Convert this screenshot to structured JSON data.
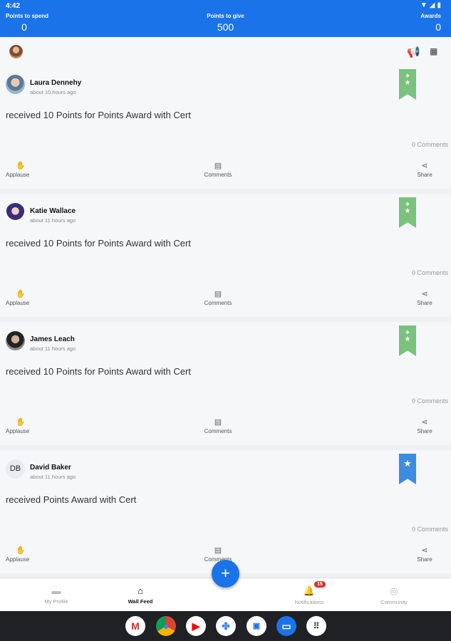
{
  "status_bar": {
    "time": "4:42"
  },
  "header": {
    "points_to_spend_label": "Points to spend",
    "points_to_spend_value": "0",
    "points_to_give_label": "Points to give",
    "points_to_give_value": "500",
    "awards_label": "Awards",
    "awards_value": "0"
  },
  "posts": [
    {
      "author": "Laura Dennehy",
      "time": "about 10 hours ago",
      "message": "received 10 Points for Points Award with Cert",
      "comments_count": "0 Comments",
      "ribbon": "green",
      "initials": ""
    },
    {
      "author": "Katie Wallace",
      "time": "about 11 hours ago",
      "message": "received 10 Points for Points Award with Cert",
      "comments_count": "0 Comments",
      "ribbon": "green",
      "initials": ""
    },
    {
      "author": "James Leach",
      "time": "about 11 hours ago",
      "message": "received 10 Points for Points Award with Cert",
      "comments_count": "0 Comments",
      "ribbon": "green",
      "initials": ""
    },
    {
      "author": "David Baker",
      "time": "about 11 hours ago",
      "message": "received Points Award with Cert",
      "comments_count": "0 Comments",
      "ribbon": "blue",
      "initials": "DB"
    }
  ],
  "actions": {
    "applause": "Applause",
    "comments": "Comments",
    "share": "Share"
  },
  "fab": "+",
  "nav": {
    "my_profile": "My Profile",
    "wall_feed": "Wall Feed",
    "notifications": "Notifications",
    "notifications_badge": "15",
    "community": "Community"
  },
  "icons": {
    "ribbon_green": "#7ac27d",
    "ribbon_blue": "#3d8ce0",
    "accent": "#1a73e8"
  }
}
